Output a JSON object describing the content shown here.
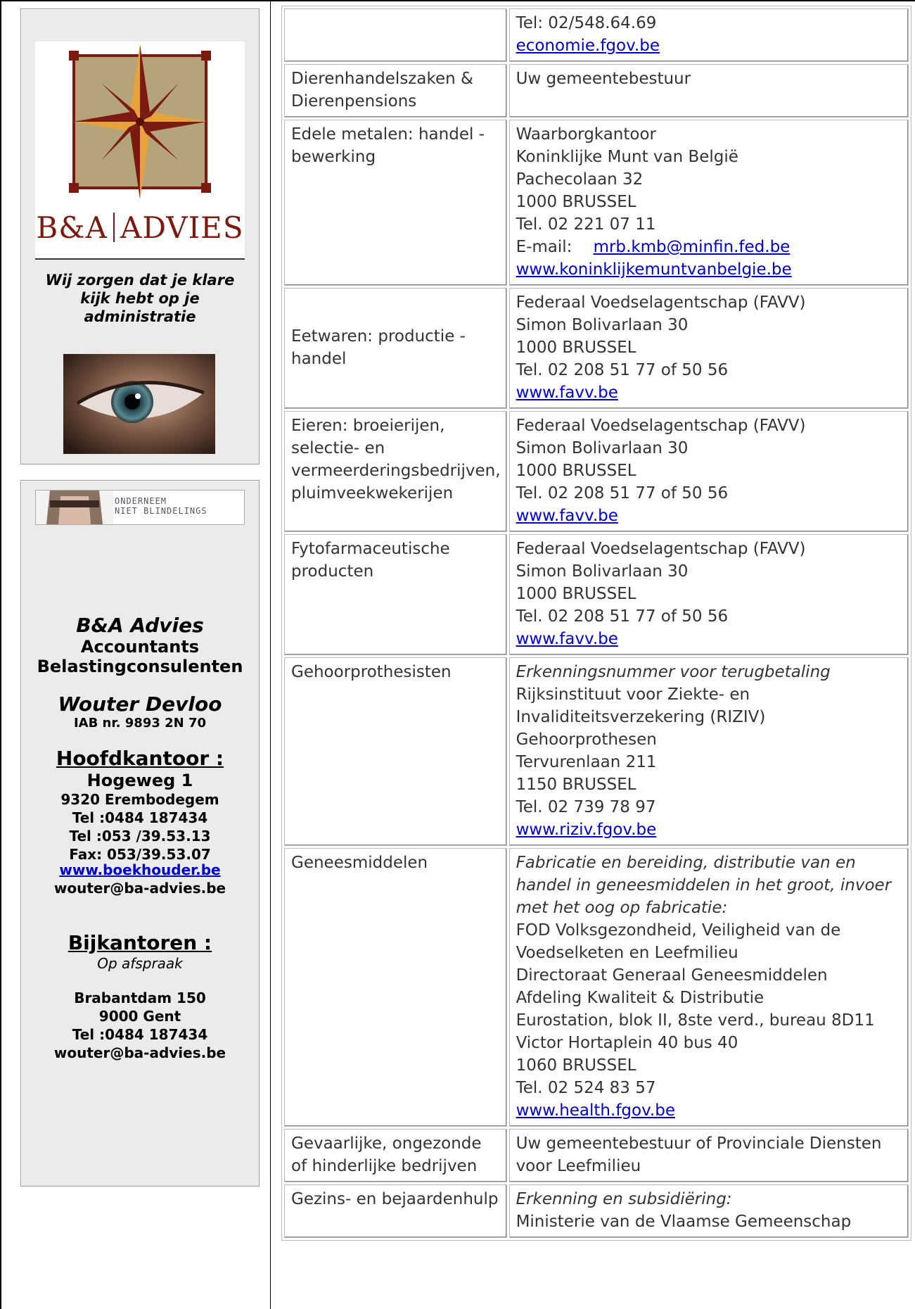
{
  "sidebar": {
    "logo_text_left": "B&A",
    "logo_text_right": "ADVIES",
    "tagline": "Wij zorgen dat je klare kijk hebt op je administratie",
    "banner_line1": "ONDERNEEM",
    "banner_line2": "NIET BLINDELINGS",
    "company": "B&A Advies",
    "role1": "Accountants",
    "role2": "Belastingconsulenten",
    "person": "Wouter Devloo",
    "iab": "IAB nr. 9893 2N 70",
    "hq_heading": "Hoofdkantoor :",
    "hq_street": "Hogeweg 1",
    "hq_city": "9320 Erembodegem",
    "hq_tel1": "Tel :0484 187434",
    "hq_tel2": "Tel :053 /39.53.13",
    "hq_fax": "Fax: 053/39.53.07",
    "website": "www.boekhouder.be",
    "email1": "wouter@ba-advies.be",
    "branch_heading": "Bijkantoren :",
    "branch_note": "Op afspraak",
    "branch_street": "Brabantdam 150",
    "branch_city": "9000 Gent",
    "branch_tel": "Tel :0484 187434",
    "email2": "wouter@ba-advies.be",
    "colors": {
      "accent_text": "#7a1a10",
      "link": "#0000cc",
      "panel_bg": "#ebebeb"
    }
  },
  "table": {
    "rows": [
      {
        "cat": "",
        "lines": [
          "Tel: 02/548.64.69"
        ],
        "link": "economie.fgov.be"
      },
      {
        "cat": "Dierenhandelszaken & Dierenpensions",
        "lines": [
          "Uw gemeentebestuur"
        ]
      },
      {
        "cat": "Edele metalen: handel - bewerking",
        "lines": [
          "Waarborgkantoor",
          "Koninklijke Munt van België",
          "Pachecolaan 32",
          "1000 BRUSSEL",
          "Tel. 02 221 07 11"
        ],
        "email_label": "E-mail:",
        "email": "mrb.kmb@minfin.fed.be",
        "link": "www.koninklijkemuntvanbelgie.be"
      },
      {
        "cat": "Eetwaren: productie - handel",
        "lines": [
          "Federaal Voedselagentschap (FAVV)",
          "Simon Bolivarlaan 30",
          "1000 BRUSSEL",
          "Tel. 02 208 51 77 of 50 56"
        ],
        "link": "www.favv.be"
      },
      {
        "cat": "Eieren: broeierijen, selectie- en vermeerderingsbedrijven, pluimveekwekerijen",
        "lines": [
          "Federaal Voedselagentschap (FAVV)",
          "Simon Bolivarlaan 30",
          "1000 BRUSSEL",
          "Tel. 02 208 51 77 of 50 56"
        ],
        "link": "www.favv.be"
      },
      {
        "cat": "Fytofarmaceutische producten",
        "lines": [
          "Federaal Voedselagentschap (FAVV)",
          "Simon Bolivarlaan 30",
          "1000 BRUSSEL",
          "Tel. 02 208 51 77 of 50 56"
        ],
        "link": "www.favv.be"
      },
      {
        "cat": "Gehoorprothesisten",
        "italic": "Erkenningsnummer voor terugbetaling",
        "lines": [
          "Rijksinstituut voor Ziekte- en Invaliditeitsverzekering (RIZIV)",
          "Gehoorprothesen",
          "Tervurenlaan 211",
          "1150 BRUSSEL",
          "Tel. 02 739 78 97"
        ],
        "link": "www.riziv.fgov.be"
      },
      {
        "cat": "Geneesmiddelen",
        "italic": "Fabricatie en bereiding, distributie van en handel in geneesmiddelen in het groot, invoer met het oog op fabricatie:",
        "lines": [
          "FOD Volksgezondheid, Veiligheid van de Voedselketen en Leefmilieu",
          "Directoraat Generaal Geneesmiddelen",
          "Afdeling Kwaliteit & Distributie",
          "Eurostation, blok II, 8ste verd., bureau 8D11",
          "Victor Hortaplein 40 bus 40",
          "1060 BRUSSEL",
          "Tel. 02 524 83 57"
        ],
        "link": "www.health.fgov.be"
      },
      {
        "cat": "Gevaarlijke, ongezonde of hinderlijke bedrijven",
        "lines": [
          "Uw gemeentebestuur of Provinciale Diensten voor Leefmilieu"
        ]
      },
      {
        "cat": "Gezins- en bejaardenhulp",
        "italic": "Erkenning en subsidiëring:",
        "lines": [
          "Ministerie van de Vlaamse Gemeenschap"
        ]
      }
    ]
  }
}
